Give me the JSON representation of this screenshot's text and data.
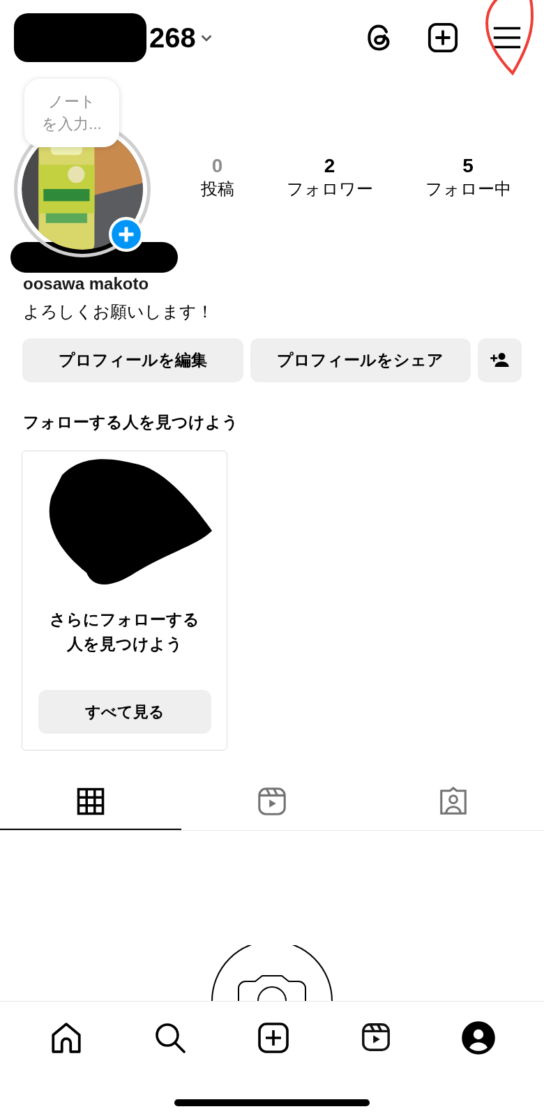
{
  "header": {
    "username": "268",
    "annotated_menu": true
  },
  "note": {
    "placeholder": [
      "ノート",
      "を入力..."
    ]
  },
  "stats": [
    {
      "value": "0",
      "label": "投稿",
      "muted": true
    },
    {
      "value": "2",
      "label": "フォロワー",
      "muted": false
    },
    {
      "value": "5",
      "label": "フォロー中",
      "muted": false
    }
  ],
  "profile": {
    "name": "oosawa makoto",
    "bio": "よろしくお願いします！"
  },
  "actions": [
    "プロフィールを編集",
    "プロフィールをシェア"
  ],
  "suggestions": {
    "title": "フォローする人を見つけよう",
    "card_text": [
      "さらにフォローする",
      "人を見つけよう"
    ],
    "button": "すべて見る"
  },
  "tabs": [
    {
      "kind": "grid",
      "selected": true
    },
    {
      "kind": "reels",
      "selected": false
    },
    {
      "kind": "tagged",
      "selected": false
    }
  ],
  "nav": [
    {
      "kind": "home",
      "selected": false
    },
    {
      "kind": "search",
      "selected": false
    },
    {
      "kind": "create",
      "selected": false
    },
    {
      "kind": "reels",
      "selected": false
    },
    {
      "kind": "profile",
      "selected": true
    }
  ]
}
